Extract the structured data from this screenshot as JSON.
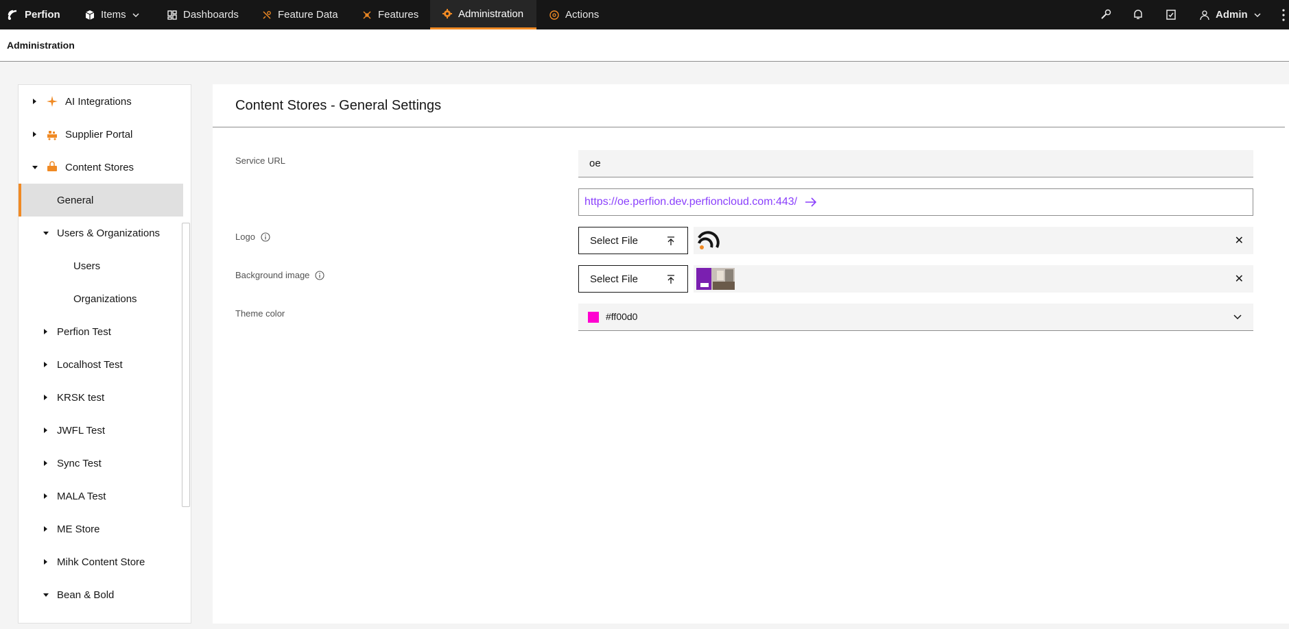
{
  "app": {
    "brand": "Perfion"
  },
  "nav": {
    "items": "Items",
    "dashboards": "Dashboards",
    "feature_data": "Feature Data",
    "features": "Features",
    "administration": "Administration",
    "actions": "Actions"
  },
  "user": {
    "name": "Admin"
  },
  "header": {
    "title": "Administration"
  },
  "sidebar": {
    "items": [
      {
        "label": "AI Integrations",
        "icon": "sparkle-icon"
      },
      {
        "label": "Supplier Portal",
        "icon": "supplier-icon"
      },
      {
        "label": "Content Stores",
        "icon": "basket-icon"
      },
      {
        "label": "General"
      },
      {
        "label": "Users & Organizations"
      },
      {
        "label": "Users"
      },
      {
        "label": "Organizations"
      },
      {
        "label": "Perfion Test"
      },
      {
        "label": "Localhost Test"
      },
      {
        "label": "KRSK test"
      },
      {
        "label": "JWFL Test"
      },
      {
        "label": "Sync Test"
      },
      {
        "label": "MALA Test"
      },
      {
        "label": "ME Store"
      },
      {
        "label": "Mihk Content Store"
      },
      {
        "label": "Bean & Bold"
      }
    ]
  },
  "main": {
    "title": "Content Stores - General Settings",
    "service_url_label": "Service URL",
    "service_url_value": "oe",
    "service_url_link": "https://oe.perfion.dev.perfioncloud.com:443/",
    "logo_label": "Logo",
    "background_label": "Background image",
    "select_file_label": "Select File",
    "theme_label": "Theme color",
    "theme_value": "#ff00d0"
  },
  "colors": {
    "accent": "#f08a24",
    "link": "#8a3ffc",
    "theme": "#ff00d0",
    "topbar": "#161616"
  }
}
